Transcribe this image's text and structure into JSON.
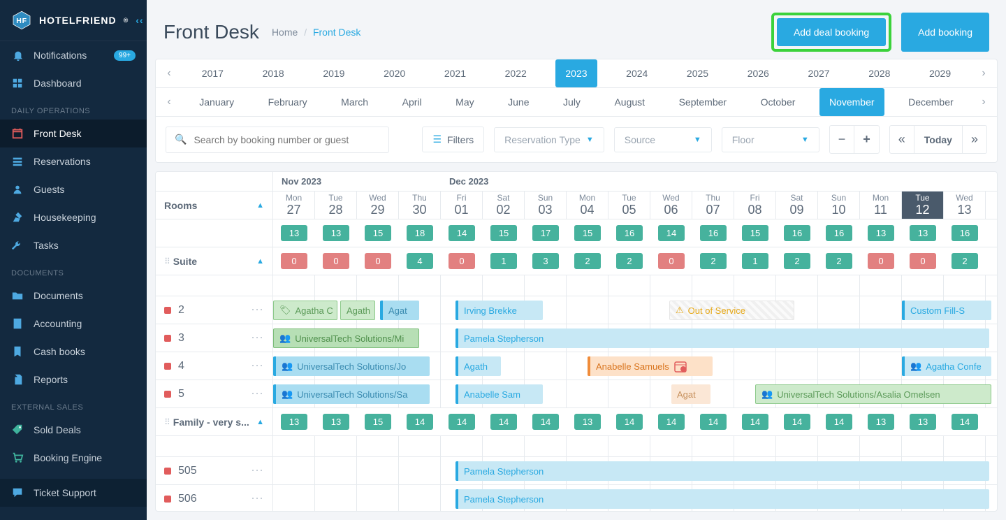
{
  "brand": "HOTELFRIEND",
  "header": {
    "title": "Front Desk",
    "crumb_home": "Home",
    "crumb_current": "Front Desk",
    "add_deal": "Add deal booking",
    "add_booking": "Add booking"
  },
  "sidebar": {
    "badge": "99+",
    "items": [
      {
        "label": "Notifications",
        "icon": "bell",
        "badge": true
      },
      {
        "label": "Dashboard",
        "icon": "dashboard"
      }
    ],
    "sections": [
      {
        "title": "DAILY OPERATIONS",
        "items": [
          {
            "label": "Front Desk",
            "icon": "calendar",
            "active": true
          },
          {
            "label": "Reservations",
            "icon": "list"
          },
          {
            "label": "Guests",
            "icon": "person"
          },
          {
            "label": "Housekeeping",
            "icon": "broom"
          },
          {
            "label": "Tasks",
            "icon": "wrench"
          }
        ]
      },
      {
        "title": "DOCUMENTS",
        "items": [
          {
            "label": "Documents",
            "icon": "folder"
          },
          {
            "label": "Accounting",
            "icon": "calc"
          },
          {
            "label": "Cash books",
            "icon": "bookmark"
          },
          {
            "label": "Reports",
            "icon": "clip"
          }
        ]
      },
      {
        "title": "EXTERNAL SALES",
        "items": [
          {
            "label": "Sold Deals",
            "icon": "tag"
          },
          {
            "label": "Booking Engine",
            "icon": "cart"
          }
        ]
      }
    ],
    "bottom": {
      "label": "Ticket Support",
      "icon": "chat"
    }
  },
  "years": [
    "2017",
    "2018",
    "2019",
    "2020",
    "2021",
    "2022",
    "2023",
    "2024",
    "2025",
    "2026",
    "2027",
    "2028",
    "2029"
  ],
  "year_active": "2023",
  "months": [
    "January",
    "February",
    "March",
    "April",
    "May",
    "June",
    "July",
    "August",
    "September",
    "October",
    "November",
    "December"
  ],
  "month_active": "November",
  "filters": {
    "search_placeholder": "Search by booking number or guest",
    "filters_label": "Filters",
    "reservation_type": "Reservation Type",
    "source": "Source",
    "floor": "Floor",
    "today": "Today"
  },
  "calendar": {
    "rooms_label": "Rooms",
    "month1": "Nov 2023",
    "month2": "Dec 2023",
    "days": [
      {
        "dow": "Mon",
        "num": "27"
      },
      {
        "dow": "Tue",
        "num": "28"
      },
      {
        "dow": "Wed",
        "num": "29"
      },
      {
        "dow": "Thu",
        "num": "30"
      },
      {
        "dow": "Fri",
        "num": "01"
      },
      {
        "dow": "Sat",
        "num": "02"
      },
      {
        "dow": "Sun",
        "num": "03"
      },
      {
        "dow": "Mon",
        "num": "04"
      },
      {
        "dow": "Tue",
        "num": "05"
      },
      {
        "dow": "Wed",
        "num": "06"
      },
      {
        "dow": "Thu",
        "num": "07"
      },
      {
        "dow": "Fri",
        "num": "08"
      },
      {
        "dow": "Sat",
        "num": "09"
      },
      {
        "dow": "Sun",
        "num": "10"
      },
      {
        "dow": "Mon",
        "num": "11"
      },
      {
        "dow": "Tue",
        "num": "12",
        "today": true
      },
      {
        "dow": "Wed",
        "num": "13"
      }
    ],
    "totals": [
      "13",
      "13",
      "15",
      "18",
      "14",
      "15",
      "17",
      "15",
      "16",
      "14",
      "16",
      "15",
      "16",
      "16",
      "13",
      "13",
      "16"
    ],
    "suite_label": "Suite",
    "suite_counts": [
      {
        "v": "0",
        "red": true
      },
      {
        "v": "0",
        "red": true
      },
      {
        "v": "0",
        "red": true
      },
      {
        "v": "4"
      },
      {
        "v": "0",
        "red": true
      },
      {
        "v": "1"
      },
      {
        "v": "3"
      },
      {
        "v": "2"
      },
      {
        "v": "2"
      },
      {
        "v": "0",
        "red": true
      },
      {
        "v": "2"
      },
      {
        "v": "1"
      },
      {
        "v": "2"
      },
      {
        "v": "2"
      },
      {
        "v": "0",
        "red": true
      },
      {
        "v": "0",
        "red": true
      },
      {
        "v": "2"
      }
    ],
    "family_label": "Family - very s...",
    "family_counts": [
      "13",
      "13",
      "15",
      "14",
      "14",
      "14",
      "14",
      "13",
      "14",
      "14",
      "14",
      "14",
      "14",
      "14",
      "13",
      "13",
      "14"
    ],
    "rooms": [
      {
        "num": "2",
        "bars": [
          {
            "cls": "green",
            "start": 0,
            "span": 1.6,
            "label": "Agatha C",
            "ico": "tag"
          },
          {
            "cls": "green",
            "start": 1.6,
            "span": 0.9,
            "label": "Agath"
          },
          {
            "cls": "blue-solid",
            "start": 2.55,
            "span": 1,
            "label": "Agat"
          },
          {
            "cls": "blue",
            "start": 4.35,
            "span": 2.15,
            "label": "Irving Brekke"
          },
          {
            "cls": "oos",
            "start": 9.45,
            "span": 3.05,
            "label": "Out of Service",
            "ico": "warn"
          },
          {
            "cls": "blue",
            "start": 15,
            "span": 2.2,
            "label": "Custom Fill-S"
          }
        ]
      },
      {
        "num": "3",
        "bars": [
          {
            "cls": "green-dark",
            "start": 0,
            "span": 3.55,
            "label": "UniversalTech Solutions/Mi",
            "ico": "group"
          },
          {
            "cls": "blue",
            "start": 4.35,
            "span": 12.8,
            "label": "Pamela Stepherson"
          }
        ]
      },
      {
        "num": "4",
        "bars": [
          {
            "cls": "blue-solid",
            "start": 0,
            "span": 3.8,
            "label": "UniversalTech Solutions/Jo",
            "ico": "group"
          },
          {
            "cls": "blue",
            "start": 4.35,
            "span": 1.15,
            "label": "Agath"
          },
          {
            "cls": "orange",
            "start": 7.5,
            "span": 3.05,
            "label": "Anabelle Samuels",
            "endico": "cal"
          },
          {
            "cls": "blue",
            "start": 15,
            "span": 2.2,
            "label": "Agatha Confe",
            "ico": "group"
          }
        ]
      },
      {
        "num": "5",
        "bars": [
          {
            "cls": "blue-solid",
            "start": 0,
            "span": 3.8,
            "label": "UniversalTech Solutions/Sa",
            "ico": "group"
          },
          {
            "cls": "blue",
            "start": 4.35,
            "span": 2.15,
            "label": "Anabelle Sam"
          },
          {
            "cls": "orange-light",
            "start": 9.5,
            "span": 1,
            "label": "Agat"
          },
          {
            "cls": "green",
            "start": 11.5,
            "span": 5.7,
            "label": "UniversalTech Solutions/Asalia Omelsen",
            "ico": "group"
          }
        ]
      }
    ],
    "plain_rooms": [
      {
        "num": "505",
        "bars": [
          {
            "cls": "blue",
            "start": 4.35,
            "span": 12.8,
            "label": "Pamela Stepherson"
          }
        ]
      },
      {
        "num": "506",
        "bars": [
          {
            "cls": "blue",
            "start": 4.35,
            "span": 12.8,
            "label": "Pamela Stepherson"
          }
        ]
      }
    ]
  }
}
